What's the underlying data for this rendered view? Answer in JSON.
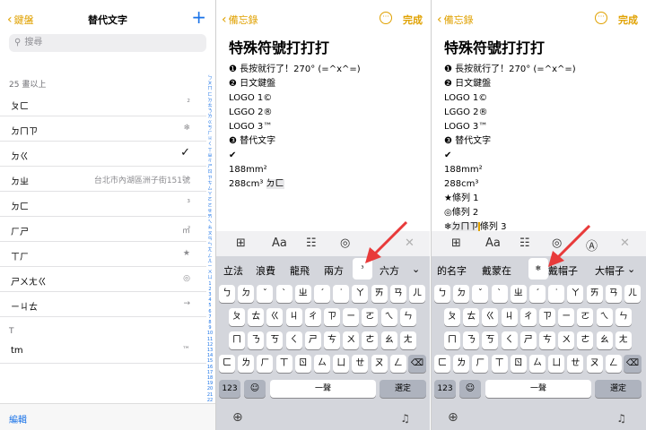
{
  "panel1": {
    "back_label": "鍵盤",
    "title": "替代文字",
    "add_label": "+",
    "search_placeholder": "搜尋",
    "section_header": "25 畫以上",
    "rows": [
      {
        "key": "ㄆㄈ",
        "value": "²"
      },
      {
        "key": "ㄉㄇㄗ",
        "value": "❄"
      },
      {
        "key": "ㄉㄍ",
        "value": "✓"
      },
      {
        "key": "ㄉㄓ",
        "value": "台北市內湖區洲子街151號"
      },
      {
        "key": "ㄉㄈ",
        "value": "³"
      },
      {
        "key": "ㄏㄕ",
        "value": "㎡"
      },
      {
        "key": "ㄒㄏ",
        "value": "★"
      },
      {
        "key": "ㄕㄨㄤㄍ",
        "value": "◎"
      },
      {
        "key": "ㄧㄐㄊ",
        "value": "→"
      }
    ],
    "section_t": "T",
    "row_tm": {
      "key": "tm",
      "value": "™"
    },
    "index": [
      "ㄅ",
      "ㄆ",
      "ㄇ",
      "ㄈ",
      "ㄉ",
      "ㄊ",
      "ㄋ",
      "ㄌ",
      "ㄍ",
      "ㄎ",
      "ㄏ",
      "ㄐ",
      "ㄑ",
      "ㄒ",
      "ㄓ",
      "ㄔ",
      "ㄕ",
      "ㄖ",
      "ㄗ",
      "ㄘ",
      "ㄙ",
      "ㄚ",
      "ㄛ",
      "ㄜ",
      "ㄝ",
      "ㄞ",
      "ㄟ",
      "ㄠ",
      "ㄡ",
      "ㄢ",
      "ㄣ",
      "ㄤ",
      "ㄥ",
      "ㄦ",
      "ㄧ",
      "ㄨ",
      "ㄩ",
      "1",
      "2",
      "3",
      "4",
      "5",
      "6",
      "7",
      "8",
      "9",
      "10",
      "11",
      "12",
      "13",
      "14",
      "15",
      "16",
      "17",
      "18",
      "19",
      "20",
      "21",
      "22",
      "23",
      "24",
      "25",
      "T",
      "#"
    ],
    "edit_label": "編輯"
  },
  "panel2": {
    "back_label": "備忘錄",
    "more_label": "···",
    "done_label": "完成",
    "heading": "特殊符號打打打",
    "lines": [
      "❶ 長按就行了！270° (=^x^=)",
      "❷ 日文鍵盤",
      "LOGO 1©",
      "LGGO 2®",
      "LOGO 3™",
      "❸ 替代文字",
      "✔",
      "188mm²",
      "288cm³ "
    ],
    "highlight": "ㄉㄈ",
    "toolbar": {
      "table": "⊞",
      "format": "Aa",
      "checklist": "☷",
      "camera": "◎",
      "close": "✕"
    },
    "candidates": [
      "立法",
      "浪費",
      "龍飛",
      "兩方",
      "³",
      "六方"
    ],
    "chevron": "⌄"
  },
  "panel3": {
    "back_label": "備忘錄",
    "more_label": "···",
    "done_label": "完成",
    "heading": "特殊符號打打打",
    "lines": [
      "❶ 長按就行了！270° (=^x^=)",
      "❷ 日文鍵盤",
      "LOGO 1©",
      "LGGO 2®",
      "LOGO 3™",
      "❸ 替代文字",
      "✔",
      "188mm²",
      "288cm³",
      "★條列 1",
      "◎條列 2"
    ],
    "last_line_prefix": "❄",
    "last_line_highlight": "ㄉㄇㄗ",
    "last_line_suffix": "條列 3",
    "toolbar": {
      "table": "⊞",
      "format": "Aa",
      "checklist": "☷",
      "camera": "◎",
      "markup": "Ⓐ",
      "close": "✕"
    },
    "candidates": [
      "的名字",
      "戴蒙在",
      "❄",
      "戴帽子",
      "大帽子"
    ],
    "chevron": "⌄"
  },
  "keyboard": {
    "row1": [
      "ㄅ",
      "ㄉ",
      "ˇ",
      "ˋ",
      "ㄓ",
      "ˊ",
      "˙",
      "ㄚ",
      "ㄞ",
      "ㄢ",
      "ㄦ"
    ],
    "row2": [
      "ㄆ",
      "ㄊ",
      "ㄍ",
      "ㄐ",
      "ㄔ",
      "ㄗ",
      "ㄧ",
      "ㄛ",
      "ㄟ",
      "ㄣ"
    ],
    "row3": [
      "ㄇ",
      "ㄋ",
      "ㄎ",
      "ㄑ",
      "ㄕ",
      "ㄘ",
      "ㄨ",
      "ㄜ",
      "ㄠ",
      "ㄤ"
    ],
    "row4": [
      "ㄈ",
      "ㄌ",
      "ㄏ",
      "ㄒ",
      "ㄖ",
      "ㄙ",
      "ㄩ",
      "ㄝ",
      "ㄡ",
      "ㄥ"
    ],
    "delete": "⌫",
    "num": "123",
    "emoji": "☺",
    "space": "一聲",
    "select": "選定",
    "globe": "🌐",
    "mic": "🎤"
  },
  "colors": {
    "accent": "#e0a100",
    "link": "#1a73e8",
    "arrow": "#e83a3a"
  }
}
